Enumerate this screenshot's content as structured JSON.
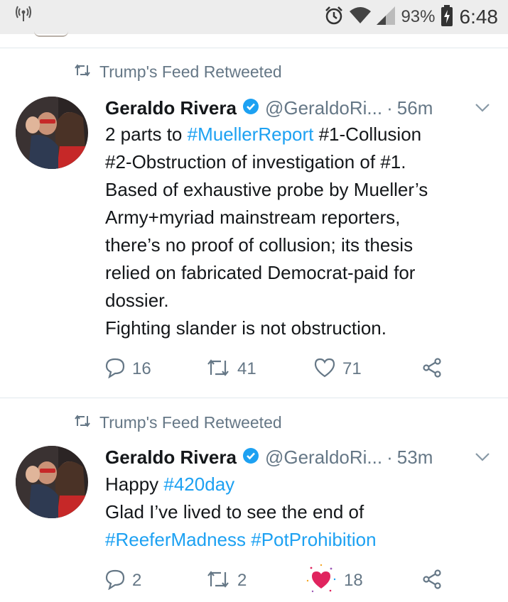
{
  "status_bar": {
    "battery_percent": "93%",
    "time": "6:48",
    "icons": [
      "signal-broadcast-icon",
      "alarm-icon",
      "wifi-icon",
      "cell-signal-icon",
      "battery-charging-icon"
    ]
  },
  "colors": {
    "link": "#1da1f2",
    "secondary": "#657786",
    "like_active": "#e0245e"
  },
  "tweets": [
    {
      "retweet_label": "Trump's Feed Retweeted",
      "name": "Geraldo Rivera",
      "handle": "@GeraldoRi...",
      "dot": "·",
      "time": "56m",
      "lines": [
        [
          {
            "t": "2 parts to "
          },
          {
            "t": "#MuellerReport",
            "tag": true
          },
          {
            "t": " #1-Collusion"
          }
        ],
        [
          {
            "t": "#2-Obstruction of investigation of #1."
          }
        ],
        [
          {
            "t": "Based of exhaustive probe by Mueller’s"
          }
        ],
        [
          {
            "t": "Army+myriad mainstream reporters,"
          }
        ],
        [
          {
            "t": "there’s no proof of collusion; its thesis"
          }
        ],
        [
          {
            "t": "relied on fabricated Democrat-paid for"
          }
        ],
        [
          {
            "t": "dossier."
          }
        ],
        [
          {
            "t": "Fighting slander is not obstruction."
          }
        ]
      ],
      "replies": "16",
      "retweets": "41",
      "likes": "71",
      "liked": false
    },
    {
      "retweet_label": "Trump's Feed Retweeted",
      "name": "Geraldo Rivera",
      "handle": "@GeraldoRi...",
      "dot": "·",
      "time": "53m",
      "lines": [
        [
          {
            "t": "Happy "
          },
          {
            "t": "#420day",
            "tag": true
          }
        ],
        [
          {
            "t": "Glad I’ve lived to see the end of"
          }
        ],
        [
          {
            "t": "#ReeferMadness",
            "tag": true
          },
          {
            "t": " "
          },
          {
            "t": "#PotProhibition",
            "tag": true
          }
        ]
      ],
      "replies": "2",
      "retweets": "2",
      "likes": "18",
      "liked": true
    }
  ]
}
